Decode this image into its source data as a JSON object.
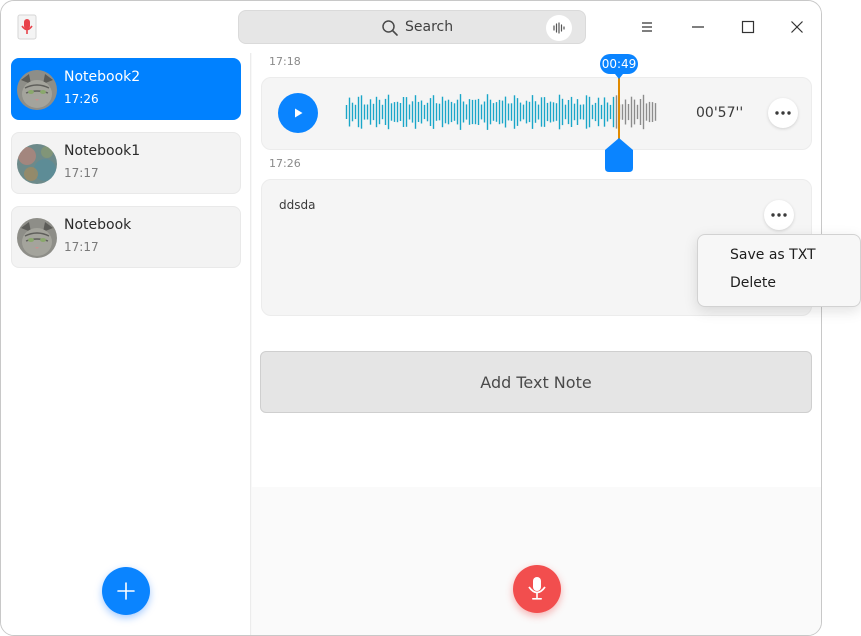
{
  "app": {
    "icon": "voice-recorder-icon"
  },
  "search": {
    "placeholder": "Search",
    "icon": "search-icon",
    "voice_icon": "voice-input-icon"
  },
  "window_controls": [
    "menu-icon",
    "minimize-icon",
    "maximize-icon",
    "close-icon"
  ],
  "sidebar": {
    "items": [
      {
        "label": "Notebook2",
        "time": "17:26",
        "selected": true,
        "avatar": "cat-avatar"
      },
      {
        "label": "Notebook1",
        "time": "17:17",
        "selected": false,
        "avatar": "texture-avatar"
      },
      {
        "label": "Notebook",
        "time": "17:17",
        "selected": false,
        "avatar": "cat-avatar"
      }
    ],
    "add_icon": "plus-icon"
  },
  "notes": {
    "voice": {
      "timestamp": "17:18",
      "duration": "00'57''",
      "playhead": "00:49",
      "progress": 0.86
    },
    "text": {
      "timestamp": "17:26",
      "content": "ddsda"
    },
    "add_text_label": "Add Text Note"
  },
  "context_menu": {
    "items": [
      "Save as TXT",
      "Delete"
    ]
  },
  "record_icon": "microphone-icon",
  "colors": {
    "accent": "#0081ff",
    "wave_played": "#1aa6c8",
    "wave_unplayed": "#8c8c8c",
    "playhead": "#e08a00",
    "record": "#f24e4e"
  }
}
